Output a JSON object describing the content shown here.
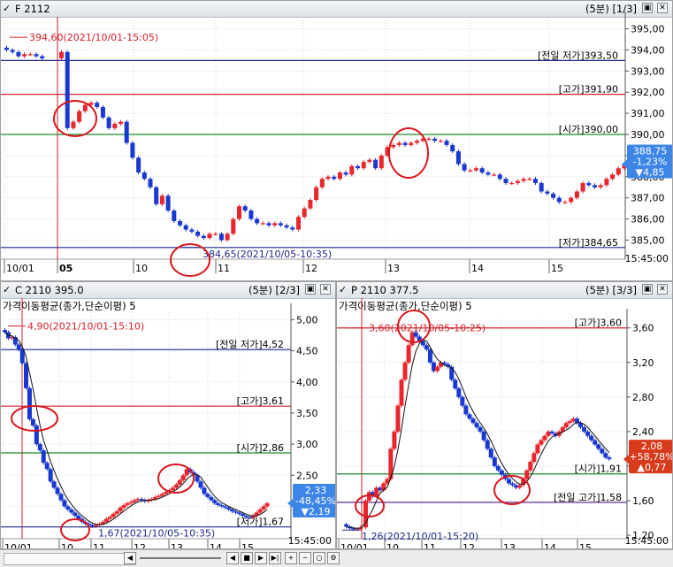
{
  "panel_main": {
    "title": "F 2112",
    "interval": "(5분)",
    "page": "[1/3]",
    "close_glyph": "✕",
    "max_glyph": "▣",
    "check_glyph": "✓",
    "end_time": "15:45:00"
  },
  "panel_call": {
    "title": "C 2110 395.0",
    "interval": "(5분)",
    "page": "[2/3]",
    "close_glyph": "✕",
    "max_glyph": "▣",
    "check_glyph": "✓",
    "indicator": "가격이동평균(종가,단순이평) 5",
    "end_time": "15:45:00"
  },
  "panel_put": {
    "title": "P 2110 377.5",
    "interval": "(5분)",
    "page": "[3/3]",
    "close_glyph": "✕",
    "max_glyph": "▣",
    "check_glyph": "✓",
    "indicator": "가격이동평균(종가,단순이평) 5",
    "end_time": "15:45:00"
  },
  "colors": {
    "up": "#e8262e",
    "down": "#1a38d0",
    "navy_line": "#1e2a8c",
    "red_line": "#d4202a",
    "green_line": "#1e8a2e",
    "purple_line": "#4b1b8a",
    "circle": "#d8181e",
    "badge_blue": "#3d86e8",
    "badge_red": "#d83a1c"
  },
  "chart_data": [
    {
      "id": "main",
      "type": "candlestick",
      "title": "F 2112",
      "x_ticks": [
        "10/01",
        "05",
        "10",
        "11",
        "12",
        "13",
        "14",
        "15"
      ],
      "y_ticks": [
        "395,00",
        "394,00",
        "393,00",
        "392,00",
        "391,00",
        "390,00",
        "389,00",
        "388,00",
        "387,00",
        "386,00",
        "385,00"
      ],
      "ylim": [
        384.6,
        395.4
      ],
      "reference_lines": [
        {
          "label": "[전일 저가]393,50",
          "value": 393.5,
          "color": "navy"
        },
        {
          "label": "[고가]391,90",
          "value": 391.9,
          "color": "red"
        },
        {
          "label": "[시가]390,00",
          "value": 390.0,
          "color": "green"
        },
        {
          "label": "[저가]384,65",
          "value": 384.65,
          "color": "navy"
        }
      ],
      "annotations": [
        {
          "text": "394,60(2021/10/01-15:05)",
          "value": 394.6
        },
        {
          "text": "384,65(2021/10/05-10:35)",
          "value": 384.65
        }
      ],
      "current": {
        "price": "388,75",
        "change_pct": "-1,23%",
        "change": "▼4,85"
      },
      "closes": [
        394.0,
        393.9,
        393.7,
        393.8,
        393.8,
        393.7,
        393.6,
        393.9,
        390.3,
        390.6,
        391.1,
        391.4,
        391.5,
        391.3,
        390.8,
        390.3,
        390.5,
        390.6,
        389.6,
        388.9,
        388.2,
        387.9,
        387.5,
        386.7,
        387.1,
        386.4,
        385.9,
        385.7,
        385.5,
        385.4,
        385.2,
        385.1,
        385.3,
        385.3,
        385.0,
        385.3,
        386.0,
        386.6,
        386.4,
        386.0,
        385.8,
        385.8,
        385.7,
        385.8,
        385.7,
        385.6,
        385.5,
        386.1,
        386.5,
        386.9,
        387.5,
        387.9,
        388.0,
        387.9,
        388.2,
        388.1,
        388.5,
        388.4,
        388.7,
        388.8,
        388.4,
        389.0,
        389.4,
        389.5,
        389.6,
        389.5,
        389.6,
        389.7,
        389.8,
        389.8,
        389.7,
        389.7,
        389.5,
        389.2,
        388.6,
        388.3,
        388.3,
        388.4,
        388.2,
        388.1,
        388.1,
        387.9,
        387.7,
        387.7,
        387.8,
        387.9,
        387.9,
        387.7,
        387.3,
        387.2,
        387.0,
        386.8,
        386.8,
        387.0,
        387.3,
        387.7,
        387.6,
        387.5,
        387.6,
        387.9,
        388.1,
        388.4,
        388.6
      ]
    },
    {
      "id": "call",
      "type": "candlestick",
      "title": "C 2110 395.0",
      "x_ticks": [
        "10/01",
        "10",
        "11",
        "12",
        "13",
        "14",
        "15"
      ],
      "y_ticks": [
        "5,00",
        "4,50",
        "4,00",
        "3,50",
        "3,00",
        "2,50",
        "2,00"
      ],
      "ylim": [
        1.58,
        5.12
      ],
      "reference_lines": [
        {
          "label": "[전일 저가]4,52",
          "value": 4.52,
          "color": "navy"
        },
        {
          "label": "[고가]3,61",
          "value": 3.61,
          "color": "red"
        },
        {
          "label": "[시가]2,86",
          "value": 2.86,
          "color": "green"
        },
        {
          "label": "[저가]1,67",
          "value": 1.67,
          "color": "navy"
        }
      ],
      "annotations": [
        {
          "text": "4,90(2021/10/01-15:10)",
          "value": 4.9
        },
        {
          "text": "1,67(2021/10/05-10:35)",
          "value": 1.67
        }
      ],
      "current": {
        "price": "2,33",
        "change_pct": "-48,45%",
        "change": "▼2,19"
      },
      "closes": [
        4.8,
        4.7,
        4.72,
        4.6,
        4.52,
        4.3,
        3.9,
        3.4,
        3.3,
        3.0,
        2.9,
        2.7,
        2.6,
        2.4,
        2.3,
        2.2,
        2.1,
        2.0,
        1.95,
        1.9,
        1.85,
        1.8,
        1.75,
        1.72,
        1.7,
        1.68,
        1.7,
        1.72,
        1.75,
        1.8,
        1.83,
        1.88,
        1.92,
        1.98,
        2.02,
        2.05,
        2.07,
        2.1,
        2.12,
        2.1,
        2.08,
        2.1,
        2.12,
        2.15,
        2.17,
        2.2,
        2.23,
        2.26,
        2.3,
        2.35,
        2.42,
        2.5,
        2.6,
        2.55,
        2.5,
        2.4,
        2.3,
        2.2,
        2.15,
        2.1,
        2.05,
        2.02,
        2.0,
        1.98,
        1.95,
        1.92,
        1.9,
        1.88,
        1.85,
        1.83,
        1.82,
        1.85,
        1.9,
        1.95,
        2.0,
        2.05
      ]
    },
    {
      "id": "put",
      "type": "candlestick",
      "title": "P 2110 377.5",
      "x_ticks": [
        "10/01",
        "10",
        "11",
        "12",
        "13",
        "14",
        "15"
      ],
      "y_ticks": [
        "3,60",
        "3,20",
        "2,80",
        "2,40",
        "2,00",
        "1,60",
        "1,20"
      ],
      "ylim": [
        1.18,
        3.72
      ],
      "reference_lines": [
        {
          "label": "[고가]3,60",
          "value": 3.6,
          "color": "red"
        },
        {
          "label": "[시가]1,91",
          "value": 1.91,
          "color": "green"
        },
        {
          "label": "[전일 고가]1,58",
          "value": 1.58,
          "color": "purple"
        }
      ],
      "annotations": [
        {
          "text": "3,60(2021/10/05-10:25)",
          "value": 3.6
        },
        {
          "text": "1,26(2021/10/01-15:20)",
          "value": 1.26
        }
      ],
      "current": {
        "price": "2,08",
        "change_pct": "+58,78%",
        "change": "▲0,77"
      },
      "closes": [
        1.3,
        1.28,
        1.27,
        1.27,
        1.29,
        1.6,
        1.7,
        1.65,
        1.75,
        1.72,
        1.8,
        1.85,
        2.2,
        2.4,
        2.7,
        3.0,
        3.2,
        3.4,
        3.55,
        3.5,
        3.45,
        3.4,
        3.35,
        3.2,
        3.1,
        3.15,
        3.2,
        3.18,
        3.15,
        3.0,
        2.9,
        2.8,
        2.7,
        2.6,
        2.55,
        2.5,
        2.45,
        2.4,
        2.3,
        2.2,
        2.1,
        2.0,
        1.95,
        1.9,
        1.85,
        1.8,
        1.78,
        1.75,
        1.78,
        1.85,
        1.95,
        2.05,
        2.15,
        2.25,
        2.3,
        2.35,
        2.4,
        2.38,
        2.35,
        2.4,
        2.45,
        2.5,
        2.52,
        2.55,
        2.5,
        2.45,
        2.4,
        2.35,
        2.3,
        2.25,
        2.2,
        2.15,
        2.1,
        2.08
      ]
    }
  ]
}
